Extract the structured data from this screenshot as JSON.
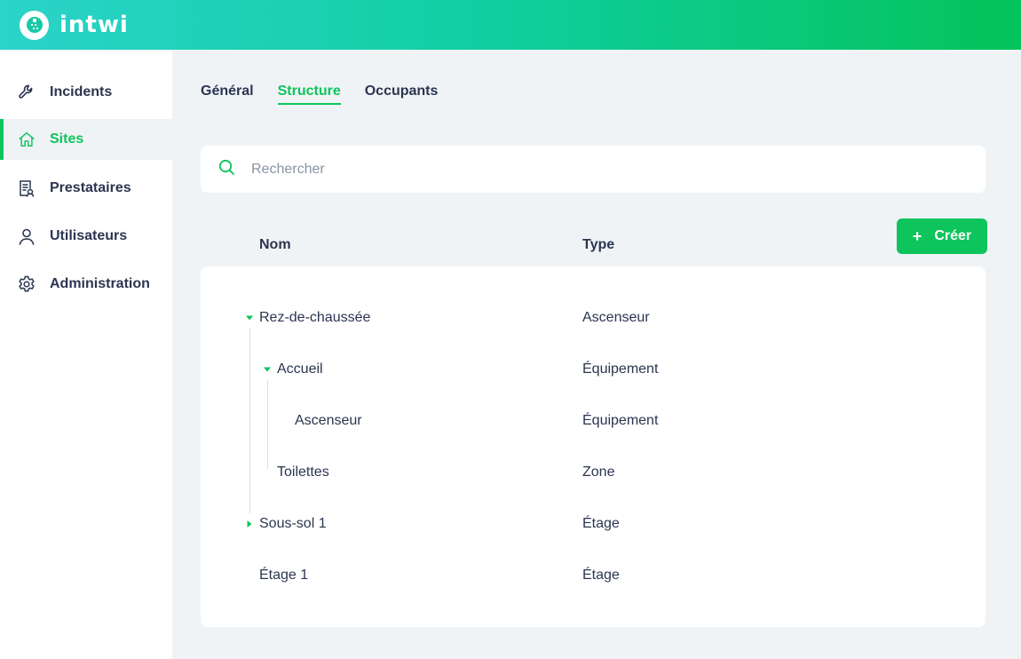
{
  "app": {
    "brand": "intwi"
  },
  "sidebar": {
    "items": [
      {
        "label": "Incidents",
        "icon": "wrench-icon",
        "active": false
      },
      {
        "label": "Sites",
        "icon": "home-icon",
        "active": true
      },
      {
        "label": "Prestataires",
        "icon": "provider-icon",
        "active": false
      },
      {
        "label": "Utilisateurs",
        "icon": "user-icon",
        "active": false
      },
      {
        "label": "Administration",
        "icon": "gear-icon",
        "active": false
      }
    ]
  },
  "tabs": [
    {
      "label": "Général",
      "active": false
    },
    {
      "label": "Structure",
      "active": true
    },
    {
      "label": "Occupants",
      "active": false
    }
  ],
  "search": {
    "placeholder": "Rechercher",
    "value": ""
  },
  "table": {
    "columns": [
      "Nom",
      "Type"
    ],
    "create_label": "Créer",
    "rows": [
      {
        "name": "Rez-de-chaussée",
        "type": "Ascenseur",
        "level": 0,
        "caret": "expanded"
      },
      {
        "name": "Accueil",
        "type": "Équipement",
        "level": 1,
        "caret": "expanded"
      },
      {
        "name": "Ascenseur",
        "type": "Équipement",
        "level": 2,
        "caret": "none"
      },
      {
        "name": "Toilettes",
        "type": "Zone",
        "level": 1,
        "caret": "none"
      },
      {
        "name": "Sous-sol 1",
        "type": "Étage",
        "level": 0,
        "caret": "collapsed"
      },
      {
        "name": "Étage 1",
        "type": "Étage",
        "level": 0,
        "caret": "none"
      }
    ]
  },
  "colors": {
    "accent": "#0ec45c",
    "text": "#2a3550",
    "background": "#f0f3f6"
  }
}
